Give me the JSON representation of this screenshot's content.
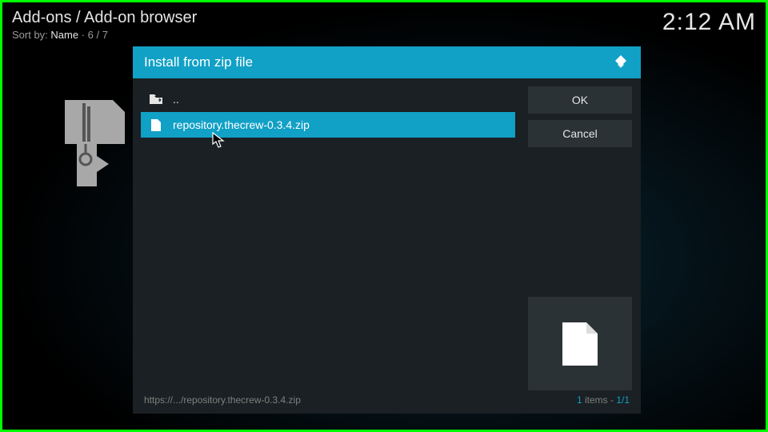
{
  "header": {
    "breadcrumb": "Add-ons / Add-on browser",
    "sort_prefix": "Sort by: ",
    "sort_value": "Name",
    "sort_count": "6 / 7",
    "clock": "2:12 AM"
  },
  "dialog": {
    "title": "Install from zip file",
    "rows": [
      {
        "icon": "folder-up",
        "label": ".."
      },
      {
        "icon": "file",
        "label": "repository.thecrew-0.3.4.zip",
        "selected": true
      }
    ],
    "buttons": {
      "ok": "OK",
      "cancel": "Cancel"
    },
    "path": "https://.../repository.thecrew-0.3.4.zip",
    "items_num": "1",
    "items_word": " items - ",
    "items_page": "1/1"
  }
}
